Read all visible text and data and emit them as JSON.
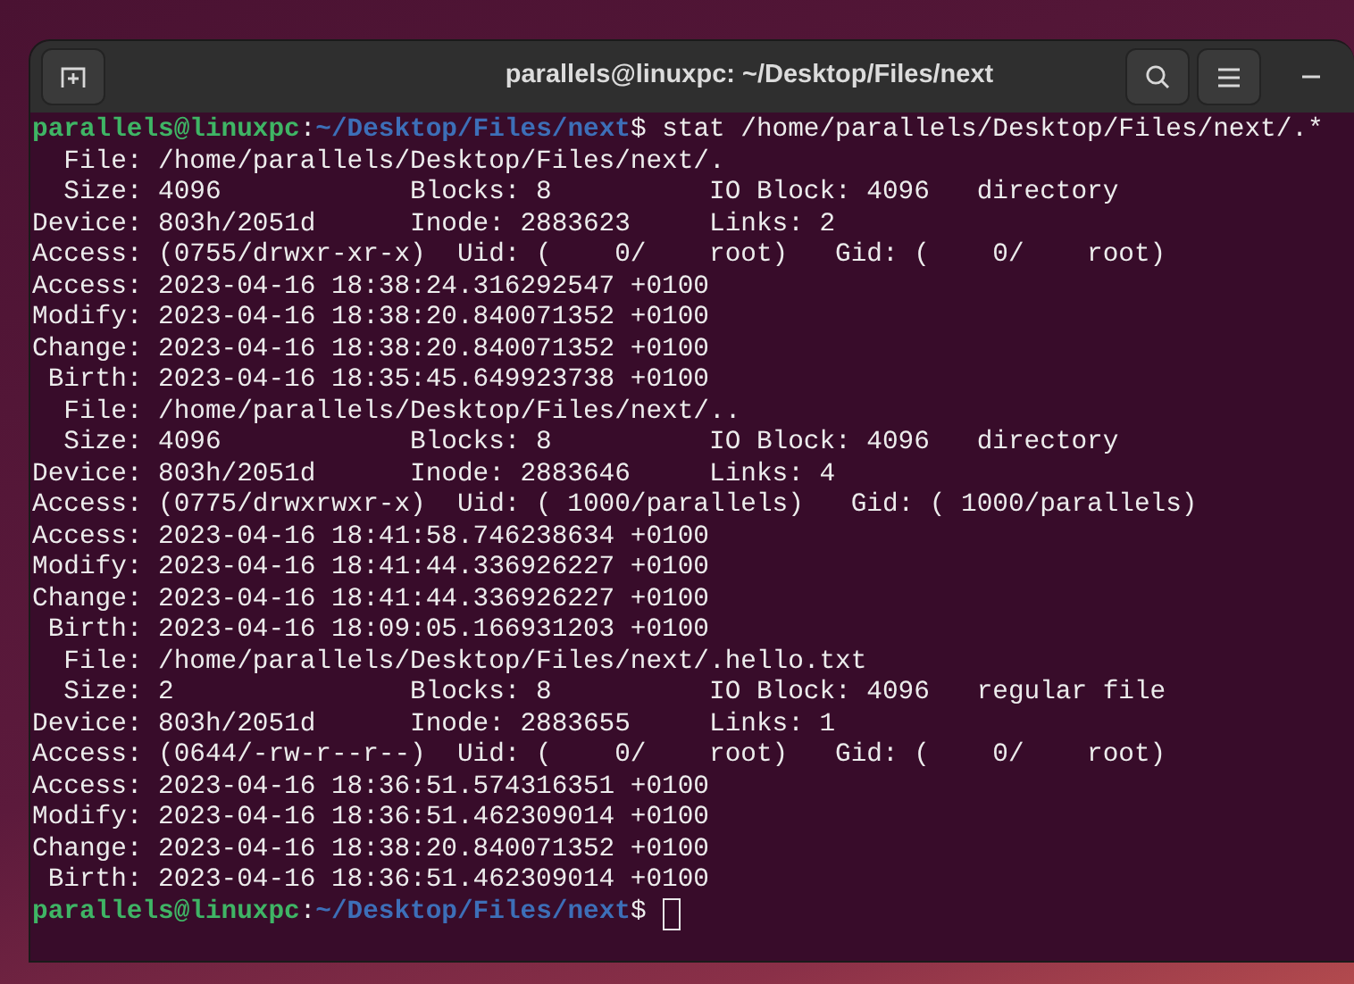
{
  "window": {
    "title": "parallels@linuxpc: ~/Desktop/Files/next"
  },
  "terminal": {
    "lines": [
      {
        "kind": "prompt",
        "user_host": "parallels@linuxpc",
        "separator": ":",
        "path": "~/Desktop/Files/next",
        "symbol": "$",
        "command": " stat /home/parallels/Desktop/Files/next/.*",
        "cursor": false
      },
      {
        "kind": "output",
        "text": "  File: /home/parallels/Desktop/Files/next/."
      },
      {
        "kind": "output",
        "text": "  Size: 4096            Blocks: 8          IO Block: 4096   directory"
      },
      {
        "kind": "output",
        "text": "Device: 803h/2051d      Inode: 2883623     Links: 2"
      },
      {
        "kind": "output",
        "text": "Access: (0755/drwxr-xr-x)  Uid: (    0/    root)   Gid: (    0/    root)"
      },
      {
        "kind": "output",
        "text": "Access: 2023-04-16 18:38:24.316292547 +0100"
      },
      {
        "kind": "output",
        "text": "Modify: 2023-04-16 18:38:20.840071352 +0100"
      },
      {
        "kind": "output",
        "text": "Change: 2023-04-16 18:38:20.840071352 +0100"
      },
      {
        "kind": "output",
        "text": " Birth: 2023-04-16 18:35:45.649923738 +0100"
      },
      {
        "kind": "output",
        "text": "  File: /home/parallels/Desktop/Files/next/.."
      },
      {
        "kind": "output",
        "text": "  Size: 4096            Blocks: 8          IO Block: 4096   directory"
      },
      {
        "kind": "output",
        "text": "Device: 803h/2051d      Inode: 2883646     Links: 4"
      },
      {
        "kind": "output",
        "text": "Access: (0775/drwxrwxr-x)  Uid: ( 1000/parallels)   Gid: ( 1000/parallels)"
      },
      {
        "kind": "output",
        "text": "Access: 2023-04-16 18:41:58.746238634 +0100"
      },
      {
        "kind": "output",
        "text": "Modify: 2023-04-16 18:41:44.336926227 +0100"
      },
      {
        "kind": "output",
        "text": "Change: 2023-04-16 18:41:44.336926227 +0100"
      },
      {
        "kind": "output",
        "text": " Birth: 2023-04-16 18:09:05.166931203 +0100"
      },
      {
        "kind": "output",
        "text": "  File: /home/parallels/Desktop/Files/next/.hello.txt"
      },
      {
        "kind": "output",
        "text": "  Size: 2               Blocks: 8          IO Block: 4096   regular file"
      },
      {
        "kind": "output",
        "text": "Device: 803h/2051d      Inode: 2883655     Links: 1"
      },
      {
        "kind": "output",
        "text": "Access: (0644/-rw-r--r--)  Uid: (    0/    root)   Gid: (    0/    root)"
      },
      {
        "kind": "output",
        "text": "Access: 2023-04-16 18:36:51.574316351 +0100"
      },
      {
        "kind": "output",
        "text": "Modify: 2023-04-16 18:36:51.462309014 +0100"
      },
      {
        "kind": "output",
        "text": "Change: 2023-04-16 18:38:20.840071352 +0100"
      },
      {
        "kind": "output",
        "text": " Birth: 2023-04-16 18:36:51.462309014 +0100"
      },
      {
        "kind": "prompt",
        "user_host": "parallels@linuxpc",
        "separator": ":",
        "path": "~/Desktop/Files/next",
        "symbol": "$",
        "cursor": true
      }
    ]
  }
}
